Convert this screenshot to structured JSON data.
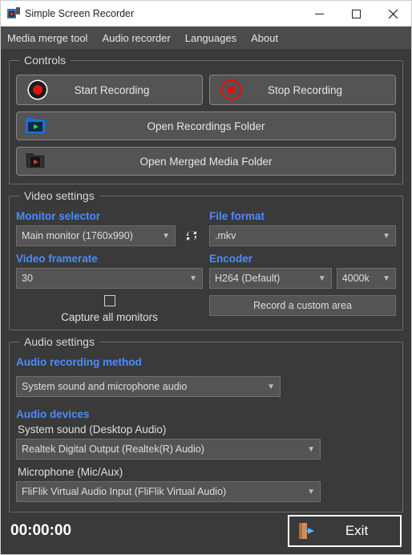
{
  "window": {
    "title": "Simple Screen Recorder"
  },
  "menu": {
    "merge": "Media merge tool",
    "audio": "Audio recorder",
    "lang": "Languages",
    "about": "About"
  },
  "controls": {
    "legend": "Controls",
    "start": "Start Recording",
    "stop": "Stop Recording",
    "open_folder": "Open Recordings Folder",
    "open_merged": "Open Merged Media Folder"
  },
  "video": {
    "legend": "Video settings",
    "monitor_label": "Monitor selector",
    "monitor_value": "Main monitor (1760x990)",
    "format_label": "File format",
    "format_value": ".mkv",
    "fps_label": "Video framerate",
    "fps_value": "30",
    "encoder_label": "Encoder",
    "encoder_value": "H264 (Default)",
    "bitrate_value": "4000k",
    "capture_all": "Capture all monitors",
    "custom_area": "Record a custom area"
  },
  "audio": {
    "legend": "Audio settings",
    "method_label": "Audio recording method",
    "method_value": "System sound and microphone audio",
    "devices_label": "Audio devices",
    "sys_label": "System sound (Desktop Audio)",
    "sys_value": "Realtek Digital Output (Realtek(R) Audio)",
    "mic_label": "Microphone (Mic/Aux)",
    "mic_value": "FliFlik Virtual Audio Input (FliFlik Virtual Audio)"
  },
  "footer": {
    "timer": "00:00:00",
    "exit": "Exit"
  }
}
